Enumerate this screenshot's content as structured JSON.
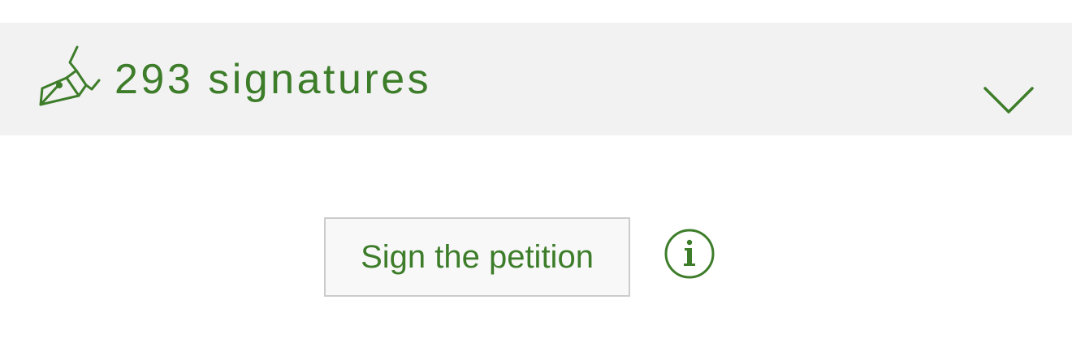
{
  "signatures": {
    "count_label": "293 signatures",
    "icon": "fountain-pen-icon",
    "expand_icon": "chevron-down-icon"
  },
  "actions": {
    "sign_label": "Sign the petition",
    "info_icon": "info-icon"
  },
  "colors": {
    "accent": "#3d7d2a",
    "bar_background": "#f2f2f2",
    "button_border": "#cccccc",
    "button_background": "#f8f8f8"
  }
}
